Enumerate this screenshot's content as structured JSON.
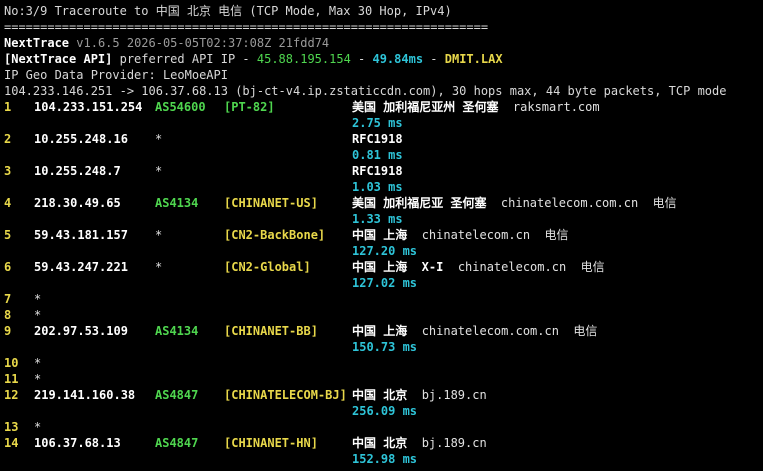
{
  "header": {
    "title": "No:3/9 Traceroute to 中国 北京 电信 (TCP Mode, Max 30 Hop, IPv4)",
    "rule": "===================================================================",
    "tool_name": "NextTrace",
    "tool_version": "v1.6.5 2026-05-05T02:37:08Z 21fdd74",
    "api_prefix": "[NextTrace API]",
    "api_text": " preferred API IP - ",
    "api_ip": "45.88.195.154",
    "api_sep1": " - ",
    "api_ms": "49.84ms",
    "api_sep2": " - ",
    "api_node": "DMIT.LAX",
    "geo_provider": "IP Geo Data Provider: LeoMoeAPI",
    "route_line": "104.233.146.251 -> 106.37.68.13 (bj-ct-v4.ip.zstaticcdn.com), 30 hops max, 44 byte packets, TCP mode"
  },
  "hops": [
    {
      "n": "1",
      "ip": "104.233.151.254",
      "asn": "AS54600",
      "tag": "[PT-82]",
      "geo": "美国 加利福尼亚州 圣何塞",
      "extra": "raksmart.com",
      "isp": "",
      "lat": "2.75 ms"
    },
    {
      "n": "2",
      "ip": "10.255.248.16",
      "asn": "*",
      "tag": "",
      "geo": "RFC1918",
      "extra": "",
      "isp": "",
      "lat": "0.81 ms"
    },
    {
      "n": "3",
      "ip": "10.255.248.7",
      "asn": "*",
      "tag": "",
      "geo": "RFC1918",
      "extra": "",
      "isp": "",
      "lat": "1.03 ms"
    },
    {
      "n": "4",
      "ip": "218.30.49.65",
      "asn": "AS4134",
      "tag": "[CHINANET-US]",
      "geo": "美国 加利福尼亚 圣何塞",
      "extra": "chinatelecom.com.cn",
      "isp": "电信",
      "lat": "1.33 ms"
    },
    {
      "n": "5",
      "ip": "59.43.181.157",
      "asn": "*",
      "tag": "[CN2-BackBone]",
      "geo": "中国 上海",
      "extra": "chinatelecom.cn",
      "isp": "电信",
      "lat": "127.20 ms"
    },
    {
      "n": "6",
      "ip": "59.43.247.221",
      "asn": "*",
      "tag": "[CN2-Global]",
      "geo": "中国 上海  X-I",
      "extra": "chinatelecom.cn",
      "isp": "电信",
      "lat": "127.02 ms"
    },
    {
      "n": "7",
      "ip": "*"
    },
    {
      "n": "8",
      "ip": "*"
    },
    {
      "n": "9",
      "ip": "202.97.53.109",
      "asn": "AS4134",
      "tag": "[CHINANET-BB]",
      "geo": "中国 上海",
      "extra": "chinatelecom.com.cn",
      "isp": "电信",
      "lat": "150.73 ms"
    },
    {
      "n": "10",
      "ip": "*"
    },
    {
      "n": "11",
      "ip": "*"
    },
    {
      "n": "12",
      "ip": "219.141.160.38",
      "asn": "AS4847",
      "tag": "[CHINATELECOM-BJ]",
      "geo": "中国 北京",
      "extra": "bj.189.cn",
      "isp": "",
      "lat": "256.09 ms"
    },
    {
      "n": "13",
      "ip": "*"
    },
    {
      "n": "14",
      "ip": "106.37.68.13",
      "asn": "AS4847",
      "tag": "[CHINANET-HN]",
      "geo": "中国 北京",
      "extra": "bj.189.cn",
      "isp": "",
      "lat": "152.98 ms"
    }
  ]
}
